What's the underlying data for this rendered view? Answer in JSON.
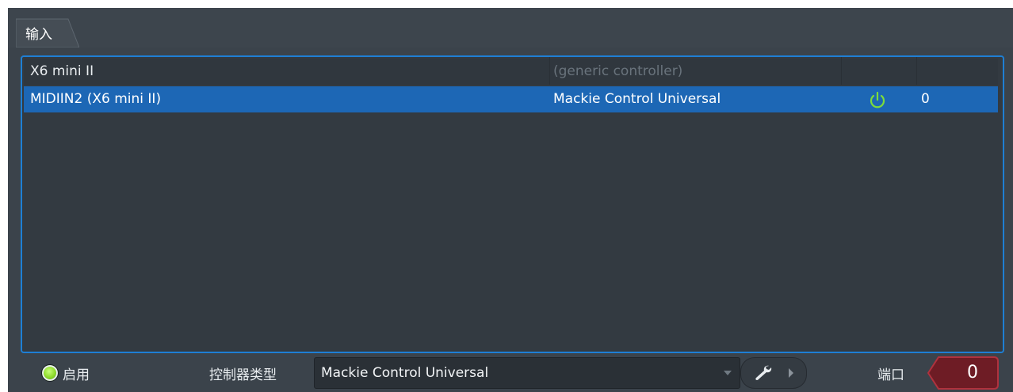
{
  "tab": {
    "label": "输入"
  },
  "columns": {
    "count": 4
  },
  "devices": [
    {
      "name": "X6 mini II",
      "controller_type": "(generic controller)",
      "enabled": false,
      "port": ""
    },
    {
      "name": "MIDIIN2 (X6 mini II)",
      "controller_type": "Mackie Control Universal",
      "enabled": true,
      "port": "0"
    }
  ],
  "selected_row": 1,
  "footer": {
    "enable_label": "启用",
    "controller_type_label": "控制器类型",
    "controller_type_value": "Mackie Control Universal",
    "port_label": "端口",
    "port_value": "0"
  },
  "colors": {
    "accent": "#1e7fd4",
    "selected_row": "#1d67b5",
    "enabled_led": "#8fdc2c",
    "port_box": "#7a1f28"
  },
  "icons": [
    "power-icon",
    "wrench-icon",
    "chevron-right-icon",
    "dropdown-caret-icon",
    "led-indicator"
  ]
}
